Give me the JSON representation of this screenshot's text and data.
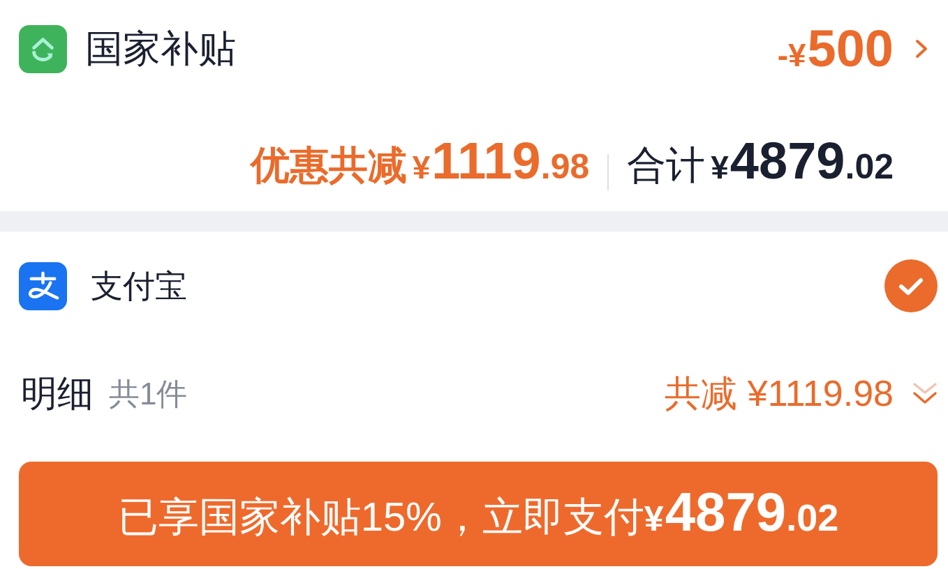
{
  "subsidy": {
    "label": "国家补贴",
    "amount": {
      "prefix": "-¥",
      "integer": "500"
    }
  },
  "summary": {
    "discount_label": "优惠共减",
    "discount": {
      "prefix": "¥",
      "integer": "1119",
      "decimal": ".98"
    },
    "total_label": "合计",
    "total": {
      "prefix": "¥",
      "integer": "4879",
      "decimal": ".02"
    }
  },
  "payment_methods": [
    {
      "name": "支付宝",
      "selected": true
    }
  ],
  "details": {
    "label": "明细",
    "count": "共1件",
    "discount": "共减 ¥1119.98"
  },
  "pay_button": {
    "text": "已享国家补贴15%，立即支付",
    "amount": {
      "prefix": "¥",
      "integer": "4879",
      "decimal": ".02"
    }
  }
}
